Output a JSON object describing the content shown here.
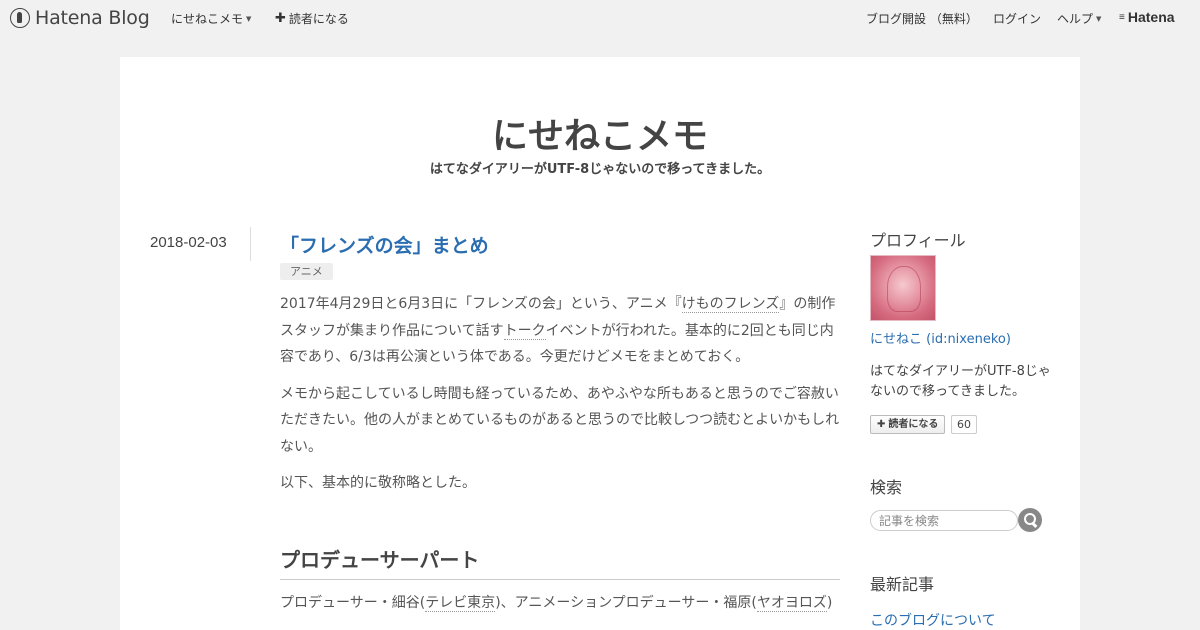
{
  "navbar": {
    "brand": "Hatena Blog",
    "blog_menu": "にせねこメモ",
    "subscribe": "読者になる",
    "open_blog": "ブログ開設 （無料）",
    "login": "ログイン",
    "help": "ヘルプ",
    "hatena": "Hatena"
  },
  "header": {
    "title": "にせねこメモ",
    "description": "はてなダイアリーがUTF-8じゃないので移ってきました。"
  },
  "entry": {
    "date": "2018-02-03",
    "title": "「フレンズの会」まとめ",
    "category": "アニメ",
    "p1": {
      "a": "2017年4月29日と6月3日に「フレンズの会」という、アニメ『",
      "kw1": "けものフレンズ",
      "b": "』の制作スタッフが集まり作品について話す",
      "kw2": "トーク",
      "c": "イベントが行われた。基本的に2回とも同じ内容であり、6/3は再公演という体である。今更だけどメモをまとめておく。"
    },
    "p2": "メモから起こしているし時間も経っているため、あやふやな所もあると思うのでご容赦いただきたい。他の人がまとめているものがあると思うので比較しつつ読むとよいかもしれない。",
    "p3": "以下、基本的に敬称略とした。",
    "section_heading": "プロデューサーパート",
    "section_text": {
      "a": "プロデューサー・細谷(",
      "kw1": "テレビ東京",
      "b": ")、アニメーションプロデューサー・福原(",
      "kw2": "ヤオヨロズ",
      "c": ")"
    }
  },
  "sidebar": {
    "profile_heading": "プロフィール",
    "profile_name": "にせねこ (id:nixeneko)",
    "profile_desc": "はてなダイアリーがUTF-8じゃないので移ってきました。",
    "subscribe_label": "読者になる",
    "subscriber_count": "60",
    "search_heading": "検索",
    "search_placeholder": "記事を検索",
    "recent_heading": "最新記事",
    "recent_items": [
      "このブログについて"
    ]
  },
  "colors": {
    "link": "#2a6db0",
    "background": "#f1f1f1",
    "content": "#ffffff"
  }
}
